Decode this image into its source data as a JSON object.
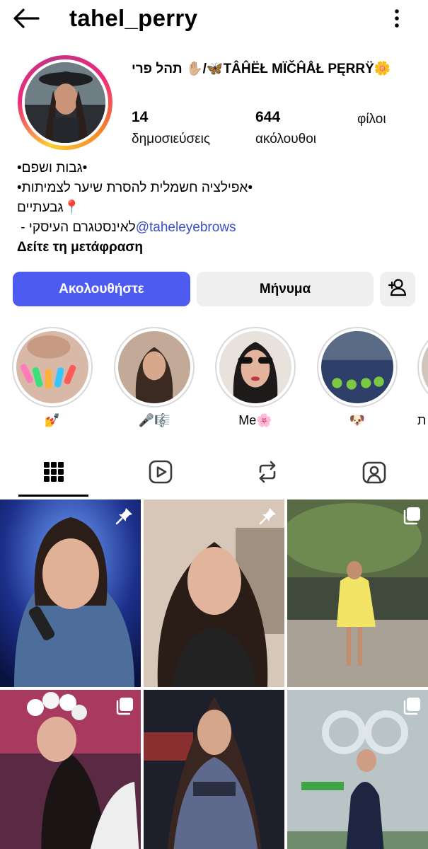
{
  "header": {
    "username": "tahel_perry"
  },
  "profile": {
    "display_name": "🌼TÂĤËŁ MÏČĤÅŁ PĘRRŸ🦋/✋🏼 תהל פרי",
    "stats": [
      {
        "value": "14",
        "label": "δημοσιεύσεις"
      },
      {
        "value": "644",
        "label": "ακόλουθοι"
      },
      {
        "value": "",
        "label": "φίλοι"
      }
    ],
    "bio": {
      "line1": "•גבות ושפם•",
      "line2": "•אפילציה חשמלית להסרת שיער לצמיתות•",
      "line3": "📍גבעתיים",
      "line4_text": " לאינסטגרם העיסקי - ",
      "line4_link": "@taheleyebrows",
      "see_translation": "Δείτε τη μετάφραση"
    }
  },
  "actions": {
    "follow_label": "Ακολουθήστε",
    "message_label": "Μήνυμα"
  },
  "highlights": [
    {
      "label": "💅"
    },
    {
      "label": "🎤🎼"
    },
    {
      "label": "Me🌸"
    },
    {
      "label": "🐶"
    },
    {
      "label": "ת"
    }
  ],
  "tabs": [
    "grid-icon",
    "reels-icon",
    "reposts-icon",
    "tagged-icon"
  ],
  "colors": {
    "follow_button": "#4e5bf0",
    "secondary_button": "#efefef",
    "link": "#3a4fc7"
  }
}
